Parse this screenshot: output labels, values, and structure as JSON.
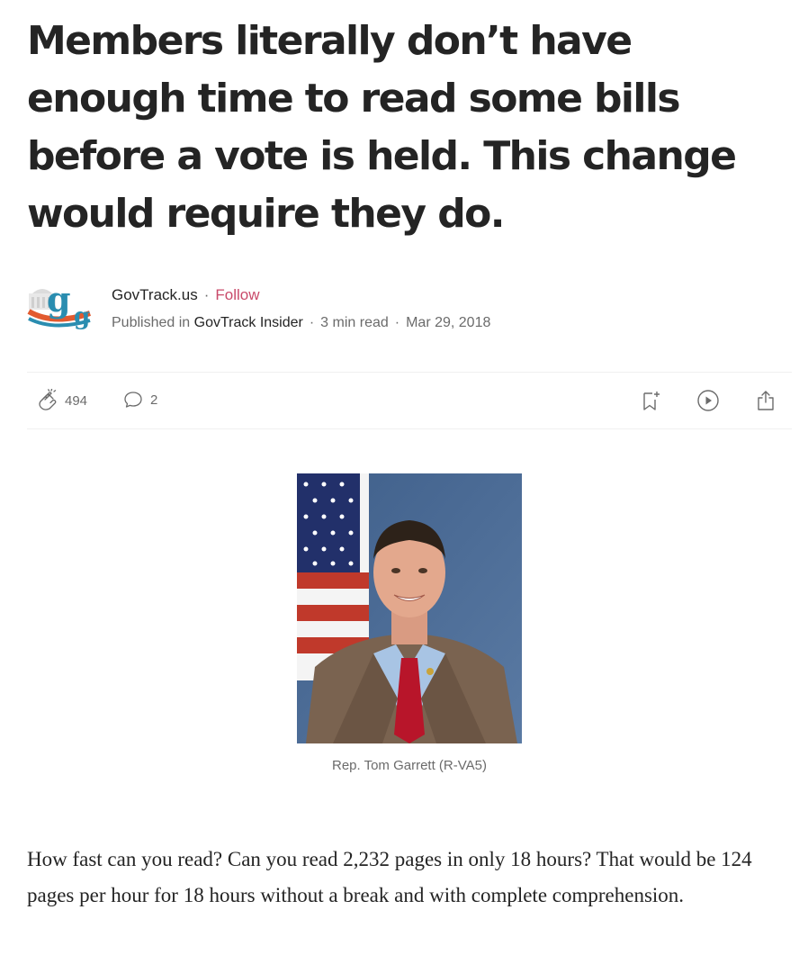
{
  "article": {
    "title": "Members literally don’t have enough time to read some bills before a vote is held. This change would require they do.",
    "author": {
      "name": "GovTrack.us",
      "separator": "·",
      "follow_label": "Follow",
      "published_prefix": "Published in",
      "publication": "GovTrack Insider",
      "read_time": "3 min read",
      "date": "Mar 29, 2018"
    },
    "actions": {
      "claps": "494",
      "responses": "2"
    },
    "image": {
      "caption": "Rep. Tom Garrett (R-VA5)"
    },
    "body_paragraph": "How fast can you read? Can you read 2,232 pages in only 18 hours? That would be 124 pages per hour for 18 hours without a break and with complete comprehension."
  },
  "colors": {
    "follow": "#c94a6a",
    "text": "#242424",
    "muted": "#6b6b6b"
  }
}
